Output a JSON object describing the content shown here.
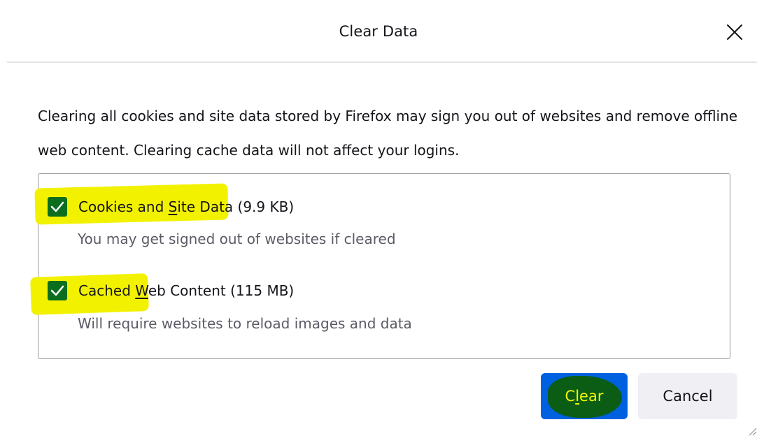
{
  "dialog": {
    "title": "Clear Data",
    "description": "Clearing all cookies and site data stored by Firefox may sign you out of websites and remove offline web content. Clearing cache data will not affect your logins."
  },
  "options": [
    {
      "label_pre": "Cookies and ",
      "label_access": "S",
      "label_post": "ite Data (9.9 KB)",
      "description": "You may get signed out of websites if cleared",
      "checked": true
    },
    {
      "label_pre": "Cached ",
      "label_access": "W",
      "label_post": "eb Content (115 MB)",
      "description": "Will require websites to reload images and data",
      "checked": true
    }
  ],
  "buttons": {
    "clear_access": "l",
    "clear_pre": "C",
    "clear_post": "ear",
    "cancel": "Cancel"
  },
  "icons": {
    "close": "close-icon",
    "check": "checkmark-icon",
    "resize": "resize-grip-icon"
  },
  "colors": {
    "primary_button": "#0061e0",
    "checkbox_fill": "#0b6e1e",
    "highlight": "#f2f200"
  }
}
